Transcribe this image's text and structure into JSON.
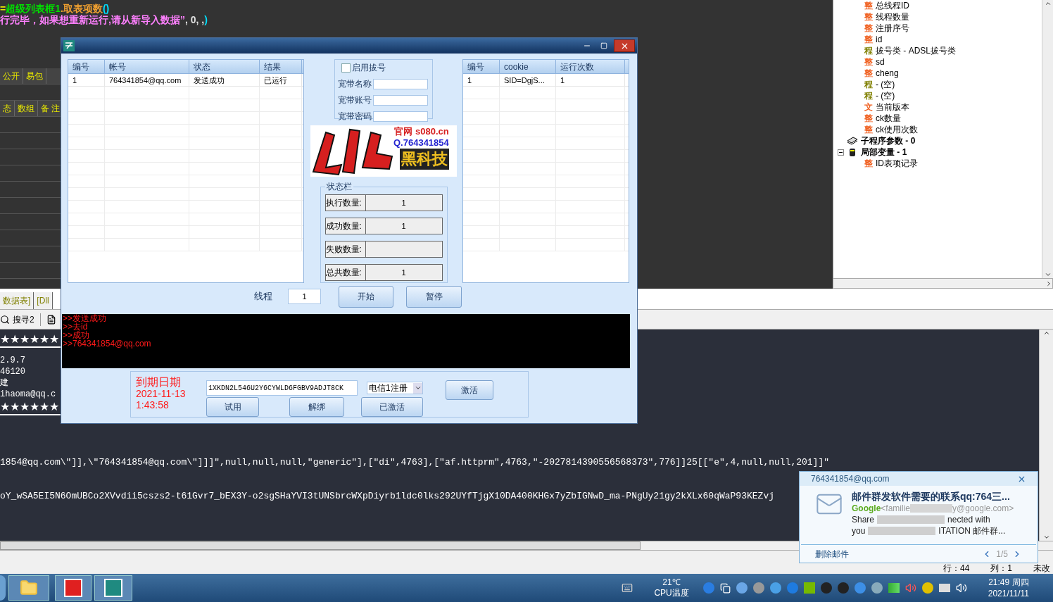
{
  "editor": {
    "code_lines": [
      {
        "parts": [
          {
            "text": "=",
            "color": "#e8e800"
          },
          {
            "text": "超级列表框1",
            "color": "#00e000"
          },
          {
            "text": ".取表项数",
            "color": "#f0a030"
          },
          {
            "text": "()",
            "color": "#00e0ff"
          }
        ]
      },
      {
        "parts": [
          {
            "text": "行完毕，如果想重新运行,请从新导入数据”",
            "color": "#ff80ff"
          },
          {
            "text": ", 0, , ",
            "color": "#e0e0e0"
          },
          {
            "text": ")",
            "color": "#00e0ff"
          }
        ]
      }
    ],
    "header_rows": [
      [
        "公开",
        "易包"
      ],
      [
        "态",
        "数组",
        "备 注"
      ]
    ]
  },
  "tree": {
    "continued_children": [
      {
        "kind": "integer",
        "badge": "整",
        "label": "总线程ID"
      },
      {
        "kind": "integer",
        "badge": "整",
        "label": "线程数量"
      },
      {
        "kind": "integer",
        "badge": "整",
        "label": "注册序号"
      },
      {
        "kind": "integer",
        "badge": "整",
        "label": "id"
      },
      {
        "kind": "routine",
        "badge": "程",
        "label": "拔号类 - ADSL拔号类"
      },
      {
        "kind": "integer",
        "badge": "整",
        "label": "sd"
      },
      {
        "kind": "integer",
        "badge": "整",
        "label": "cheng"
      },
      {
        "kind": "routine",
        "badge": "程",
        "label": "- (空)"
      },
      {
        "kind": "routine",
        "badge": "程",
        "label": "- (空)"
      },
      {
        "kind": "text",
        "badge": "文",
        "label": "当前版本"
      },
      {
        "kind": "integer",
        "badge": "整",
        "label": "ck数量"
      },
      {
        "kind": "integer",
        "badge": "整",
        "label": "ck使用次数"
      }
    ],
    "nodes": [
      {
        "kind": "params",
        "label": "子程序参数 - 0"
      },
      {
        "kind": "locals",
        "label": "局部变量 - 1",
        "expanded": true,
        "children": [
          {
            "kind": "integer",
            "badge": "整",
            "label": "ID表项记录"
          }
        ]
      }
    ]
  },
  "doc_tabs": [
    "数据表]",
    "[Dll"
  ],
  "toolbar": {
    "search_label": "搜寻2"
  },
  "output": {
    "left_lines": [
      {
        "kind": "stars",
        "text": "★★★★★★"
      },
      {
        "kind": "text",
        "text": "2.9.7"
      },
      {
        "kind": "text",
        "text": "46120"
      },
      {
        "kind": "text",
        "text": "建"
      },
      {
        "kind": "text",
        "text": "ihaoma@qq.c"
      },
      {
        "kind": "stars",
        "text": "★★★★★★"
      }
    ],
    "long_lines": [
      "1854@qq.com\\\"]],\\\"764341854@qq.com\\\"]]]\",null,null,null,\"generic\"],[\"di\",4763],[\"af.httprm\",4763,\"-2027814390556568373\",776]]25[[\"e\",4,null,null,201]]\"",
      "oY_wSA5EI5N6OmUBCo2XVvdii5cszs2-t61Gvr7_bEX3Y-o2sgSHaYVI3tUNSbrcWXpDiyrb1ldc0lks292UYfTjgX10DA400KHGx7yZbIGNwD_ma-PNgUy21gy2kXLx60qWaP93KEZvj"
    ]
  },
  "status_bar": [
    "行：44",
    "列：1",
    "未改"
  ],
  "dialog": {
    "accounts_table": {
      "columns": [
        "编号",
        "帐号",
        "状态",
        "结果"
      ],
      "rows": [
        [
          "1",
          "764341854@qq.com",
          "发送成功",
          "已运行"
        ]
      ]
    },
    "dialup": {
      "enable": {
        "label": "启用拔号",
        "checked": false
      },
      "fields": [
        {
          "label": "宽带名称"
        },
        {
          "label": "宽带账号"
        },
        {
          "label": "宽带密码"
        }
      ]
    },
    "logo": {
      "site": "官网 s080.cn",
      "qq": "Q.764341854",
      "slogan": "黑科技"
    },
    "status_group": {
      "title": "状态栏",
      "rows": [
        {
          "label": "执行数量:",
          "value": "1"
        },
        {
          "label": "成功数量:",
          "value": "1"
        },
        {
          "label": "失败数量:"
        },
        {
          "label": "总共数量:",
          "value": "1"
        }
      ]
    },
    "cookie_table": {
      "columns": [
        "编号",
        "cookie",
        "运行次数"
      ],
      "rows": [
        [
          "1",
          "SID=DgjS...",
          "1"
        ]
      ]
    },
    "threads": {
      "label": "线程",
      "value": "1"
    },
    "buttons": [
      "开始",
      "暂停"
    ],
    "log": [
      ">>发送成功",
      ">>去id",
      ">>成功",
      ">>764341854@qq.com"
    ],
    "license": {
      "expiry_label": "到期日期",
      "expiry_date": "2021-11-13",
      "expiry_time": "1:43:58",
      "key": "1XKDN2L546U2Y6CYWLD6FGBV9ADJT8CK",
      "line": "电信1注册",
      "buttons": [
        "激活",
        "试用",
        "解绑",
        "已激活"
      ]
    }
  },
  "notification": {
    "account": "764341854@qq.com",
    "subject": "邮件群发软件需要的联系qq:764三...",
    "sender": "Google",
    "address_start": "<familie",
    "address_end": "y@google.com>",
    "body": [
      [
        "Share",
        "nected with"
      ],
      [
        "you",
        "ITATION   邮件群..."
      ]
    ],
    "action": "删除邮件",
    "page": "1/5"
  },
  "taskbar": {
    "temperature": "21℃",
    "temperature_label": "CPU温度",
    "time": "21:49 周四",
    "date": "2021/11/11"
  }
}
